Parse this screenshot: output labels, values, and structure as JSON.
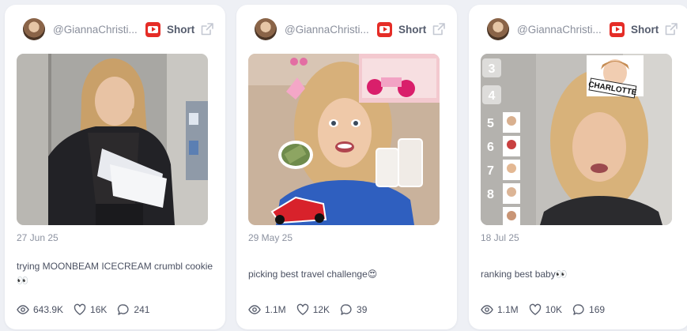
{
  "cards": [
    {
      "handle": "@GiannaChristi...",
      "type_label": "Short",
      "date": "27 Jun 25",
      "caption": "trying MOONBEAM ICECREAM crumbl cookie👀",
      "views": "643.9K",
      "likes": "16K",
      "comments": "241"
    },
    {
      "handle": "@GiannaChristi...",
      "type_label": "Short",
      "date": "29 May 25",
      "caption": "picking best travel challenge😍",
      "views": "1.1M",
      "likes": "12K",
      "comments": "39"
    },
    {
      "handle": "@GiannaChristi...",
      "type_label": "Short",
      "date": "18 Jul 25",
      "caption": "ranking best baby👀",
      "views": "1.1M",
      "likes": "10K",
      "comments": "169"
    }
  ],
  "thumbnail_overlays": {
    "card3_name_tag": "CHARLOTTE",
    "card3_rank_numbers": [
      "3",
      "4",
      "5",
      "6",
      "7",
      "8"
    ]
  },
  "icons": {
    "platform": "youtube-icon",
    "external": "external-link-icon",
    "views": "eye-icon",
    "likes": "heart-icon",
    "comments": "comment-icon"
  },
  "colors": {
    "background": "#eef0f5",
    "card": "#ffffff",
    "youtube_red": "#e52d27",
    "muted_text": "#8c92a0"
  }
}
